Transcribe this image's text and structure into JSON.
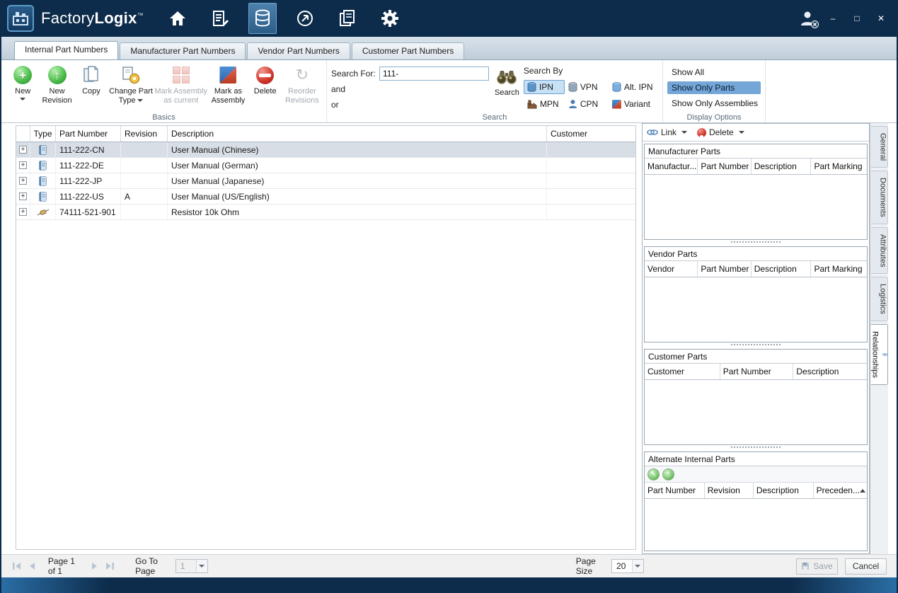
{
  "titlebar": {
    "app_name_a": "Factory",
    "app_name_b": "Logix",
    "trademark": "™"
  },
  "tabs": [
    {
      "label": "Internal Part Numbers"
    },
    {
      "label": "Manufacturer Part Numbers"
    },
    {
      "label": "Vendor Part Numbers"
    },
    {
      "label": "Customer Part Numbers"
    }
  ],
  "ribbon": {
    "groups": {
      "basics_label": "Basics",
      "search_label": "Search",
      "display_label": "Display Options"
    },
    "buttons": {
      "new": "New",
      "new_revision": "New Revision",
      "copy": "Copy",
      "change_part_type": "Change Part Type",
      "mark_current": "Mark Assembly as current",
      "mark_assembly": "Mark as Assembly",
      "delete": "Delete",
      "reorder": "Reorder Revisions"
    },
    "search": {
      "search_for_label": "Search For:",
      "value": "111-",
      "and": "and",
      "or": "or",
      "button": "Search",
      "by_label": "Search By",
      "options": [
        {
          "label": "IPN"
        },
        {
          "label": "VPN"
        },
        {
          "label": "Alt. IPN"
        },
        {
          "label": "MPN"
        },
        {
          "label": "CPN"
        },
        {
          "label": "Variant"
        }
      ]
    },
    "display": {
      "options": [
        {
          "label": "Show All"
        },
        {
          "label": "Show Only Parts"
        },
        {
          "label": "Show Only Assemblies"
        }
      ]
    }
  },
  "grid": {
    "columns": {
      "type": "Type",
      "part_number": "Part Number",
      "revision": "Revision",
      "description": "Description",
      "customer": "Customer"
    },
    "rows": [
      {
        "part_number": "111-222-CN",
        "revision": "",
        "description": "User Manual (Chinese)",
        "customer": ""
      },
      {
        "part_number": "111-222-DE",
        "revision": "",
        "description": "User Manual (German)",
        "customer": ""
      },
      {
        "part_number": "111-222-JP",
        "revision": "",
        "description": "User Manual (Japanese)",
        "customer": ""
      },
      {
        "part_number": "111-222-US",
        "revision": "A",
        "description": "User Manual (US/English)",
        "customer": ""
      },
      {
        "part_number": "74111-521-901",
        "revision": "",
        "description": "Resistor 10k Ohm",
        "customer": ""
      }
    ]
  },
  "relationships": {
    "link_label": "Link",
    "delete_label": "Delete",
    "manufacturer": {
      "title": "Manufacturer Parts",
      "columns": [
        "Manufactur...",
        "Part Number",
        "Description",
        "Part Marking"
      ]
    },
    "vendor": {
      "title": "Vendor Parts",
      "columns": [
        "Vendor",
        "Part Number",
        "Description",
        "Part Marking"
      ]
    },
    "customer": {
      "title": "Customer Parts",
      "columns": [
        "Customer",
        "Part Number",
        "Description"
      ]
    },
    "alternate": {
      "title": "Alternate Internal Parts",
      "columns": [
        "Part Number",
        "Revision",
        "Description",
        "Preceden..."
      ]
    }
  },
  "side_tabs": [
    {
      "label": "General"
    },
    {
      "label": "Documents"
    },
    {
      "label": "Attributes"
    },
    {
      "label": "Logistics"
    },
    {
      "label": "Relationships"
    }
  ],
  "footer": {
    "page_status": "Page 1 of 1",
    "goto_label": "Go To Page",
    "goto_value": "1",
    "page_size_label": "Page Size",
    "page_size_value": "20",
    "save": "Save",
    "cancel": "Cancel"
  }
}
